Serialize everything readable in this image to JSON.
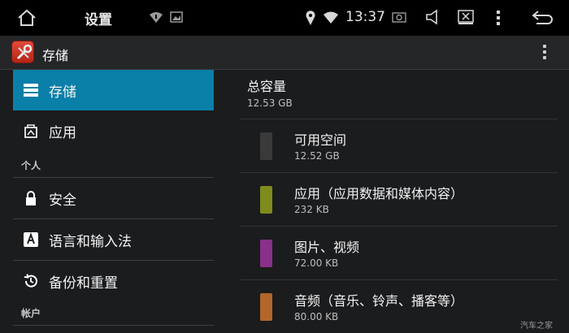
{
  "status_bar": {
    "title": "设置",
    "time": "13:37",
    "icons": [
      "home-icon",
      "wifi-alert-icon",
      "picture-icon",
      "location-icon",
      "wifi-icon",
      "screenshot-icon",
      "volume-icon",
      "close-window-icon",
      "more-vert-icon",
      "back-icon"
    ]
  },
  "action_bar": {
    "title": "存储",
    "app_icon": "settings-tools-icon"
  },
  "nav": {
    "items": [
      {
        "label": "存储",
        "icon": "storage-icon",
        "selected": true
      },
      {
        "label": "应用",
        "icon": "apps-icon",
        "selected": false
      }
    ],
    "section_personal": "个人",
    "personal_items": [
      {
        "label": "安全",
        "icon": "lock-icon"
      },
      {
        "label": "语言和输入法",
        "icon": "keyboard-a-icon"
      },
      {
        "label": "备份和重置",
        "icon": "restore-icon"
      }
    ],
    "section_accounts": "帐户"
  },
  "storage": {
    "total_label": "总容量",
    "total_value": "12.53 GB",
    "rows": [
      {
        "label": "可用空间",
        "value": "12.52 GB",
        "color": "#3a3a3a"
      },
      {
        "label": "应用（应用数据和媒体内容）",
        "value": "232 KB",
        "color": "#7e8c1c"
      },
      {
        "label": "图片、视频",
        "value": "72.00 KB",
        "color": "#8a2f8a"
      },
      {
        "label": "音频（音乐、铃声、播客等）",
        "value": "80.00 KB",
        "color": "#b2662a"
      }
    ]
  },
  "watermark": "汽车之家"
}
